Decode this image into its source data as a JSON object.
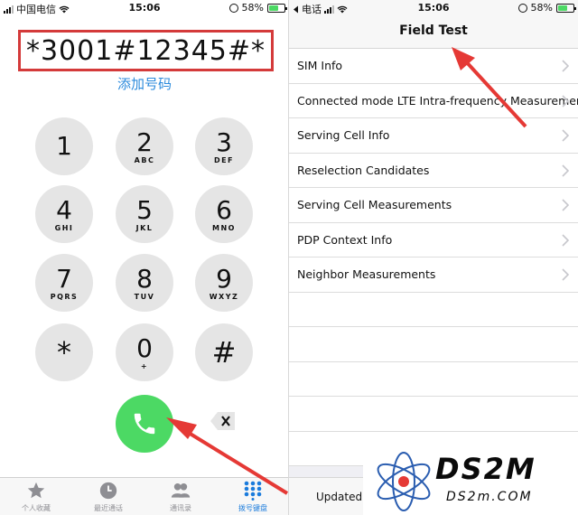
{
  "colors": {
    "accent": "#2c8bdc",
    "call_green": "#4cd964",
    "arrow_red": "#e53935",
    "box_red": "#d43a3a",
    "key_gray": "#e5e5e5"
  },
  "left_status": {
    "carrier": "中国电信",
    "time": "15:06",
    "battery": "58%"
  },
  "right_status": {
    "back_app": "电话",
    "time": "15:06",
    "battery": "58%"
  },
  "dialer": {
    "number": "*3001#12345#*",
    "add_number": "添加号码",
    "keys": [
      {
        "digit": "1",
        "letters": ""
      },
      {
        "digit": "2",
        "letters": "ABC"
      },
      {
        "digit": "3",
        "letters": "DEF"
      },
      {
        "digit": "4",
        "letters": "GHI"
      },
      {
        "digit": "5",
        "letters": "JKL"
      },
      {
        "digit": "6",
        "letters": "MNO"
      },
      {
        "digit": "7",
        "letters": "PQRS"
      },
      {
        "digit": "8",
        "letters": "TUV"
      },
      {
        "digit": "9",
        "letters": "WXYZ"
      },
      {
        "digit": "*",
        "letters": ""
      },
      {
        "digit": "0",
        "letters": "+"
      },
      {
        "digit": "#",
        "letters": ""
      }
    ],
    "call_icon": "phone-icon",
    "delete_icon": "backspace-icon"
  },
  "tabbar": [
    {
      "label": "个人收藏",
      "icon": "star-icon"
    },
    {
      "label": "最近通话",
      "icon": "clock-icon"
    },
    {
      "label": "通讯录",
      "icon": "contacts-icon"
    },
    {
      "label": "拨号键盘",
      "icon": "keypad-icon",
      "active": true
    }
  ],
  "field_test": {
    "title": "Field Test",
    "items": [
      "SIM Info",
      "Connected mode LTE Intra-frequency Measurement",
      "Serving Cell Info",
      "Reselection Candidates",
      "Serving Cell Measurements",
      "PDP Context Info",
      "Neighbor Measurements"
    ],
    "updated_label": "Updated"
  },
  "watermark": {
    "brand": "DS2M",
    "site": "DS2m.COM"
  }
}
